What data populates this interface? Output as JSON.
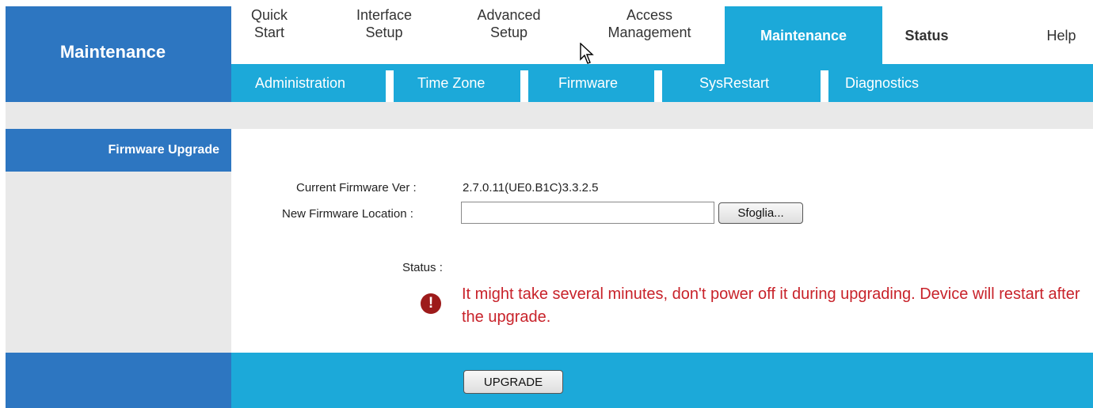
{
  "header": {
    "title": "Maintenance"
  },
  "nav": {
    "tabs": [
      {
        "line1": "Quick",
        "line2": "Start"
      },
      {
        "line1": "Interface",
        "line2": "Setup"
      },
      {
        "line1": "Advanced",
        "line2": "Setup"
      },
      {
        "line1": "Access",
        "line2": "Management"
      },
      {
        "line1": "Maintenance",
        "line2": ""
      },
      {
        "line1": "Status",
        "line2": ""
      },
      {
        "line1": "Help",
        "line2": ""
      }
    ],
    "active": "Maintenance"
  },
  "subnav": {
    "items": [
      "Administration",
      "Time Zone",
      "Firmware",
      "SysRestart",
      "Diagnostics"
    ]
  },
  "sidebar": {
    "section_label": "Firmware Upgrade"
  },
  "firmware": {
    "current_label": "Current Firmware Ver :",
    "current_value": "2.7.0.11(UE0.B1C)3.3.2.5",
    "location_label": "New Firmware Location :",
    "location_value": "",
    "browse_label": "Sfoglia...",
    "status_label": "Status :",
    "warning_text": "It might take several minutes, don't power off it during upgrading. Device will restart after the upgrade.",
    "upgrade_label": "UPGRADE"
  },
  "colors": {
    "brand_blue": "#2d76c1",
    "accent_cyan": "#1ca9d9",
    "warning_red": "#c8222a"
  },
  "icons": {
    "warning": "exclamation-circle-icon",
    "cursor": "mouse-pointer-icon"
  }
}
